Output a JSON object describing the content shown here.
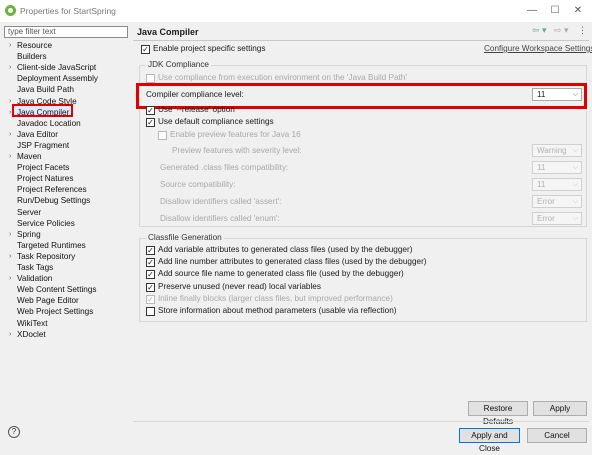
{
  "window": {
    "title": "Properties for StartSpring",
    "controls": [
      "—",
      "☐",
      "✕"
    ]
  },
  "filter": {
    "placeholder": "type filter text"
  },
  "tree": [
    {
      "label": "Resource",
      "expand": true
    },
    {
      "label": "Builders",
      "expand": false
    },
    {
      "label": "Client-side JavaScript",
      "expand": true
    },
    {
      "label": "Deployment Assembly",
      "expand": false
    },
    {
      "label": "Java Build Path",
      "expand": false
    },
    {
      "label": "Java Code Style",
      "expand": true
    },
    {
      "label": "Java Compiler",
      "expand": true,
      "selected": true
    },
    {
      "label": "Javadoc Location",
      "expand": false
    },
    {
      "label": "Java Editor",
      "expand": true
    },
    {
      "label": "JSP Fragment",
      "expand": false
    },
    {
      "label": "Maven",
      "expand": true
    },
    {
      "label": "Project Facets",
      "expand": false
    },
    {
      "label": "Project Natures",
      "expand": false
    },
    {
      "label": "Project References",
      "expand": false
    },
    {
      "label": "Run/Debug Settings",
      "expand": false
    },
    {
      "label": "Server",
      "expand": false
    },
    {
      "label": "Service Policies",
      "expand": false
    },
    {
      "label": "Spring",
      "expand": true
    },
    {
      "label": "Targeted Runtimes",
      "expand": false
    },
    {
      "label": "Task Repository",
      "expand": true
    },
    {
      "label": "Task Tags",
      "expand": false
    },
    {
      "label": "Validation",
      "expand": true
    },
    {
      "label": "Web Content Settings",
      "expand": false
    },
    {
      "label": "Web Page Editor",
      "expand": false
    },
    {
      "label": "Web Project Settings",
      "expand": false
    },
    {
      "label": "WikiText",
      "expand": false
    },
    {
      "label": "XDoclet",
      "expand": true
    }
  ],
  "page": {
    "title": "Java Compiler",
    "enable_project_specific": {
      "label": "Enable project specific settings",
      "checked": true
    },
    "configure_link": "Configure Workspace Settings...",
    "jdk_group_title": "JDK Compliance",
    "use_exec_env": {
      "label": "Use compliance from execution environment on the 'Java Build Path'",
      "checked": false
    },
    "compliance_level": {
      "label": "Compiler compliance level:",
      "value": "11"
    },
    "use_release": {
      "label": "Use '--release' option",
      "checked": true
    },
    "use_default": {
      "label": "Use default compliance settings",
      "checked": true
    },
    "enable_preview": {
      "label": "Enable preview features for Java 16",
      "checked": false
    },
    "preview_severity": {
      "label": "Preview features with severity level:",
      "value": "Warning"
    },
    "generated_compat": {
      "label": "Generated .class files compatibility:",
      "value": "11"
    },
    "source_compat": {
      "label": "Source compatibility:",
      "value": "11"
    },
    "disallow_assert": {
      "label": "Disallow identifiers called 'assert':",
      "value": "Error"
    },
    "disallow_enum": {
      "label": "Disallow identifiers called 'enum':",
      "value": "Error"
    },
    "classfile_group_title": "Classfile Generation",
    "classfile_options": [
      {
        "label": "Add variable attributes to generated class files (used by the debugger)",
        "checked": true,
        "disabled": false
      },
      {
        "label": "Add line number attributes to generated class files (used by the debugger)",
        "checked": true,
        "disabled": false
      },
      {
        "label": "Add source file name to generated class file (used by the debugger)",
        "checked": true,
        "disabled": false
      },
      {
        "label": "Preserve unused (never read) local variables",
        "checked": true,
        "disabled": false
      },
      {
        "label": "Inline finally blocks (larger class files, but improved performance)",
        "checked": true,
        "disabled": true
      },
      {
        "label": "Store information about method parameters (usable via reflection)",
        "checked": false,
        "disabled": false
      }
    ]
  },
  "buttons": {
    "restore_defaults": "Restore Defaults",
    "apply": "Apply",
    "apply_and_close": "Apply and Close",
    "cancel": "Cancel"
  },
  "icons": {
    "help": "?",
    "back": "⇦ ▾",
    "forward": "⇨ ▾",
    "menu": "⋮"
  },
  "colors": {
    "highlight_border": "#e00000",
    "selection": "#cde4f8"
  }
}
